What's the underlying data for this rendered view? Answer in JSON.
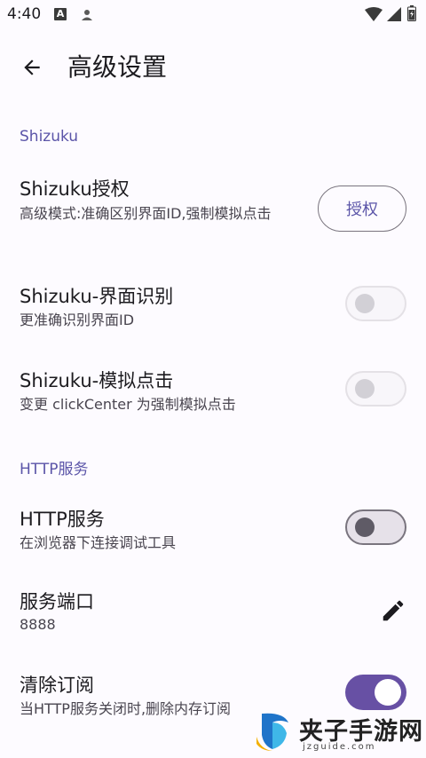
{
  "status_bar": {
    "time": "4:40",
    "notification_letter": "A",
    "icons": [
      "notification-a-icon",
      "person-icon",
      "wifi-icon",
      "signal-icon",
      "battery-icon"
    ]
  },
  "app_bar": {
    "title": "高级设置",
    "back_icon": "arrow-back-icon"
  },
  "sections": [
    {
      "header": "Shizuku",
      "items": [
        {
          "title": "Shizuku授权",
          "summary": "高级模式:准确区别界面ID,强制模拟点击",
          "action_label": "授权"
        },
        {
          "title": "Shizuku-界面识别",
          "summary": "更准确识别界面ID",
          "switch": "off-disabled"
        },
        {
          "title": "Shizuku-模拟点击",
          "summary": "变更 clickCenter 为强制模拟点击",
          "switch": "off-disabled"
        }
      ]
    },
    {
      "header": "HTTP服务",
      "items": [
        {
          "title": "HTTP服务",
          "summary": "在浏览器下连接调试工具",
          "switch": "off"
        },
        {
          "title": "服务端口",
          "summary": "8888",
          "action_icon": "edit-icon"
        },
        {
          "title": "清除订阅",
          "summary": "当HTTP服务关闭时,删除内存订阅",
          "switch": "on"
        }
      ]
    }
  ],
  "watermark": {
    "text": "夹子手游网",
    "subtext": "jzguide.com"
  },
  "colors": {
    "accent": "#6750a4",
    "section_header": "#5b55a8",
    "background": "#fdfbff",
    "text_primary": "#1c1b1f",
    "text_secondary": "#49454f"
  }
}
